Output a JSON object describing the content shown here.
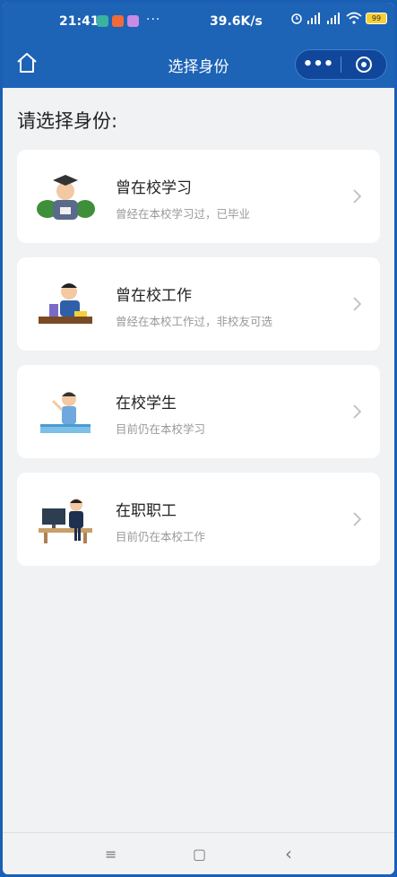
{
  "status_bar": {
    "time": "21:41",
    "dots": "···",
    "speed": "39.6K/s",
    "battery": "99"
  },
  "nav": {
    "title": "选择身份",
    "more_label": "•••"
  },
  "heading": "请选择身份:",
  "cards": [
    {
      "title": "曾在校学习",
      "subtitle": "曾经在本校学习过，已毕业",
      "icon": "graduate-illustration"
    },
    {
      "title": "曾在校工作",
      "subtitle": "曾经在本校工作过，非校友可选",
      "icon": "teacher-desk-illustration"
    },
    {
      "title": "在校学生",
      "subtitle": "目前仍在本校学习",
      "icon": "student-illustration"
    },
    {
      "title": "在职职工",
      "subtitle": "目前仍在本校工作",
      "icon": "staff-computer-illustration"
    }
  ],
  "bottom_nav": {
    "menu": "≡",
    "home": "▢",
    "back": "‹"
  },
  "colors": {
    "nav_blue": "#1d63b6",
    "background": "#f1f2f4",
    "card": "#ffffff"
  }
}
